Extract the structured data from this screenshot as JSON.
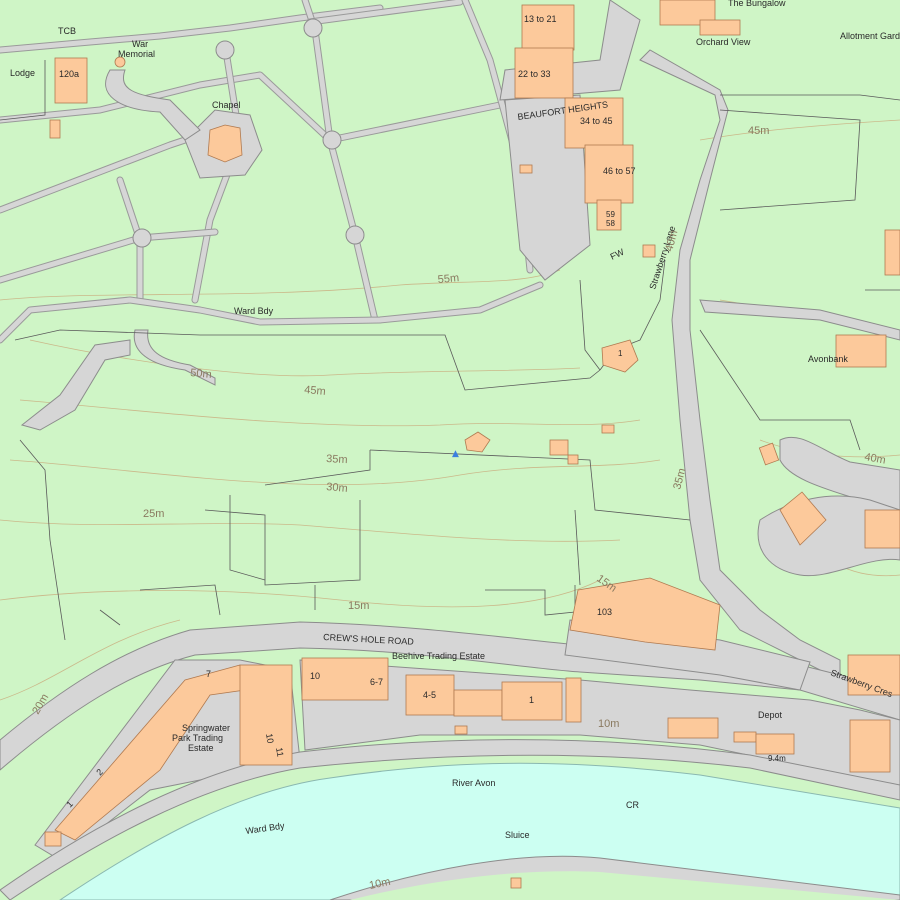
{
  "map": {
    "road_labels": {
      "crews_hole_road": "CREW'S HOLE ROAD",
      "beaufort_heights": "BEAUFORT HEIGHTS",
      "strawberry_lane": "Strawberry Lane",
      "strawberry_cres": "Strawberry Cres",
      "tcb": "TCB",
      "fw": "FW"
    },
    "place_labels": {
      "lodge": "Lodge",
      "war_memorial_1": "War",
      "war_memorial_2": "Memorial",
      "chapel": "Chapel",
      "the_bungalow": "The Bungalow",
      "orchard_view": "Orchard View",
      "allotment": "Allotment Gard",
      "avonbank": "Avonbank",
      "springwater_1": "Springwater",
      "springwater_2": "Park Trading",
      "springwater_3": "Estate",
      "beehive": "Beehive Trading Estate",
      "depot": "Depot",
      "river_avon": "River Avon",
      "cr": "CR",
      "sluice": "Sluice",
      "ward_bdy_1": "Ward Bdy",
      "ward_bdy_2": "Ward Bdy"
    },
    "house_numbers": {
      "n120a": "120a",
      "n13to21": "13 to 21",
      "n22to33": "22 to 33",
      "n34to45": "34 to 45",
      "n46to57": "46 to 57",
      "n59": "59",
      "n58": "58",
      "n1_lane": "1",
      "n103": "103",
      "n10": "10",
      "n6to7": "6-7",
      "n4to5": "4-5",
      "n1_beehive": "1",
      "n7": "7",
      "n10b": "10",
      "n11": "11",
      "n2": "2",
      "n1_spring": "1"
    },
    "contours": {
      "c55": "55m",
      "c50": "50m",
      "c45": "45m",
      "c45b": "45m",
      "c40": "40m",
      "c40b": "40m",
      "c35": "35m",
      "c35b": "35m",
      "c30": "30m",
      "c25": "25m",
      "c20": "20m",
      "c15": "15m",
      "c15b": "15m",
      "c10": "10m",
      "c10b": "10m",
      "c9_4": "9.4m"
    },
    "colors": {
      "land": "#cff5c6",
      "road": "#d6d6d6",
      "building": "#fcc99b",
      "water": "#ccfff2",
      "contour": "#c9a97a"
    }
  }
}
